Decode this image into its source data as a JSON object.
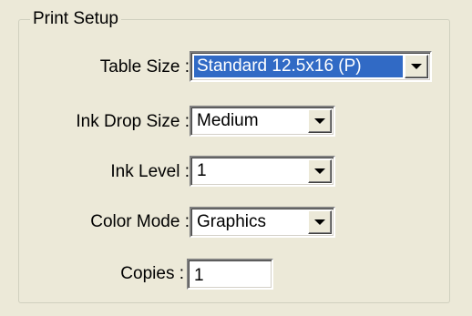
{
  "print_setup": {
    "title": "Print Setup",
    "table_size": {
      "label": "Table Size :",
      "value": "Standard 12.5x16 (P)"
    },
    "ink_drop_size": {
      "label": "Ink Drop Size :",
      "value": "Medium"
    },
    "ink_level": {
      "label": "Ink Level :",
      "value": "1"
    },
    "color_mode": {
      "label": "Color Mode :",
      "value": "Graphics"
    },
    "copies": {
      "label": "Copies :",
      "value": "1"
    }
  },
  "icons": {
    "dropdown": "chevron-down-icon"
  },
  "colors": {
    "background": "#ece9d8",
    "selection": "#316ac5",
    "groupbox_border": "#d0d0bf"
  }
}
